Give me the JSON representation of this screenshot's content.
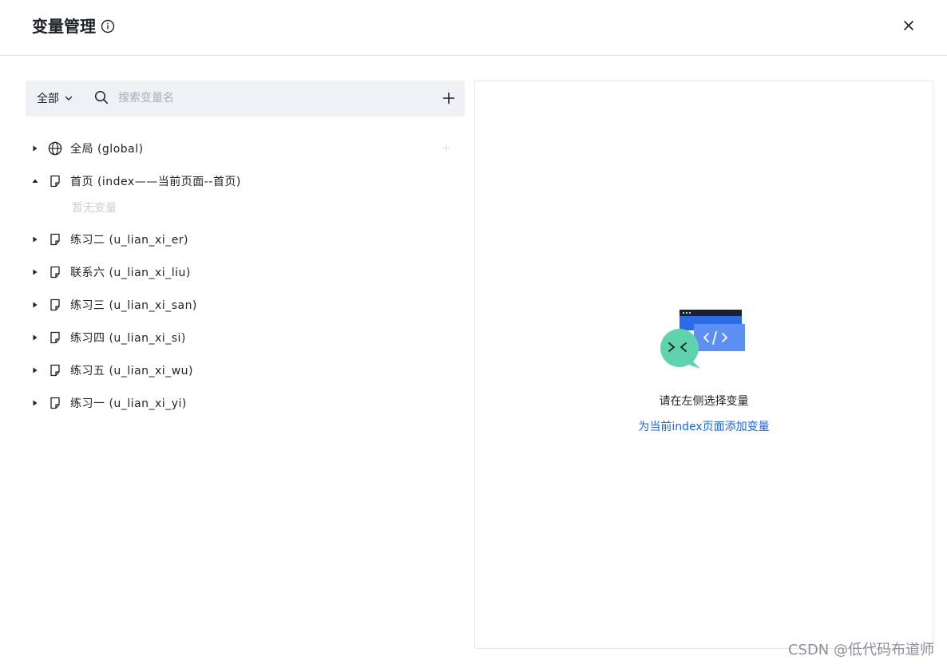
{
  "dialog": {
    "title": "变量管理",
    "close_icon": "close-icon",
    "info_icon": "info-icon"
  },
  "toolbar": {
    "scope_value": "全部",
    "search_placeholder": "搜索变量名",
    "add_icon": "plus-icon"
  },
  "tree": {
    "items": [
      {
        "label": "全局 (global)",
        "icon": "globe-icon",
        "expanded": false
      },
      {
        "label": "首页 (index——当前页面--首页)",
        "icon": "page-icon",
        "expanded": true,
        "empty_text": "暂无变量"
      },
      {
        "label": "练习二 (u_lian_xi_er)",
        "icon": "page-icon",
        "expanded": false
      },
      {
        "label": "联系六 (u_lian_xi_liu)",
        "icon": "page-icon",
        "expanded": false
      },
      {
        "label": "练习三 (u_lian_xi_san)",
        "icon": "page-icon",
        "expanded": false
      },
      {
        "label": "练习四 (u_lian_xi_si)",
        "icon": "page-icon",
        "expanded": false
      },
      {
        "label": "练习五 (u_lian_xi_wu)",
        "icon": "page-icon",
        "expanded": false
      },
      {
        "label": "练习一 (u_lian_xi_yi)",
        "icon": "page-icon",
        "expanded": false
      }
    ]
  },
  "detail": {
    "hint": "请在左侧选择变量",
    "add_link": "为当前index页面添加变量"
  },
  "watermark": "CSDN @低代码布道师",
  "colors": {
    "accent": "#1664ff",
    "toolbar_bg": "#f0f1f4",
    "border": "#e5e6eb",
    "muted_text": "#c9cdd4"
  }
}
